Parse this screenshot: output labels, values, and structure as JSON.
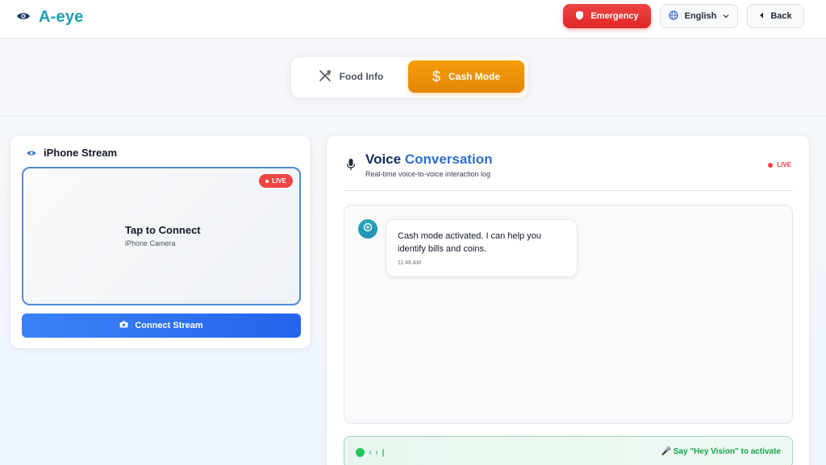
{
  "app": {
    "name": "A-eye",
    "colors": {
      "brand": "#1aa3b4",
      "emergency": "#ef4444",
      "cash": "#f59e0b",
      "primary": "#3b82f6",
      "live": "#ef4444",
      "wake": "#16a34a"
    }
  },
  "header": {
    "emergency_label": "Emergency",
    "language_label": "English",
    "back_label": "Back"
  },
  "modes": {
    "tabs": [
      {
        "label": "Food Info",
        "icon": "utensils-icon",
        "active": false
      },
      {
        "label": "Cash Mode",
        "icon": "dollar-icon",
        "active": true
      }
    ]
  },
  "stream": {
    "title": "iPhone Stream",
    "live_badge": "LIVE",
    "tap_title": "Tap to Connect",
    "tap_subtitle": "iPhone Camera",
    "connect_label": "Connect Stream"
  },
  "voice": {
    "title_part1": "Voice",
    "title_part2": "Conversation",
    "subtitle": "Real-time voice-to-voice interaction log",
    "live_label": "LIVE",
    "messages": [
      {
        "text": "Cash mode activated. I can help you identify bills and coins.",
        "time": "11:46 AM"
      }
    ],
    "wake_hint": "🎤 Say \"Hey Vision\" to activate"
  }
}
